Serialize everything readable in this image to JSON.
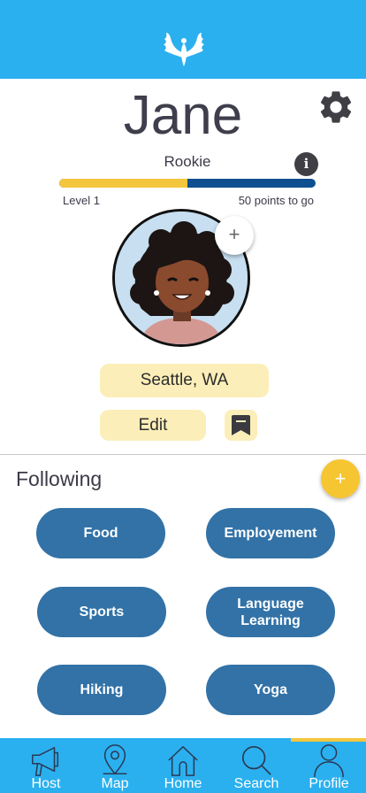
{
  "header": {
    "logo_icon": "bird-wings-logo"
  },
  "profile": {
    "name": "Jane",
    "rank": "Rookie",
    "level_label": "Level 1",
    "points_to_go": "50 points to go",
    "progress": 0.5,
    "location": "Seattle, WA",
    "edit_label": "Edit",
    "add_photo_symbol": "+"
  },
  "info_symbol": "i",
  "following": {
    "title": "Following",
    "add_symbol": "+",
    "items": [
      "Food",
      "Employement",
      "Sports",
      "Language Learning",
      "Hiking",
      "Yoga"
    ]
  },
  "nav": {
    "active": "Profile",
    "items": [
      {
        "label": "Host",
        "icon": "megaphone-icon"
      },
      {
        "label": "Map",
        "icon": "map-pin-icon"
      },
      {
        "label": "Home",
        "icon": "home-icon"
      },
      {
        "label": "Search",
        "icon": "search-icon"
      },
      {
        "label": "Profile",
        "icon": "person-icon"
      }
    ]
  },
  "colors": {
    "header_blue": "#2bb0ef",
    "chip_blue": "#3272a7",
    "accent_yellow": "#f4c63d",
    "pale_yellow": "#fbeeb8",
    "progress_dark": "#0e4f8f"
  }
}
